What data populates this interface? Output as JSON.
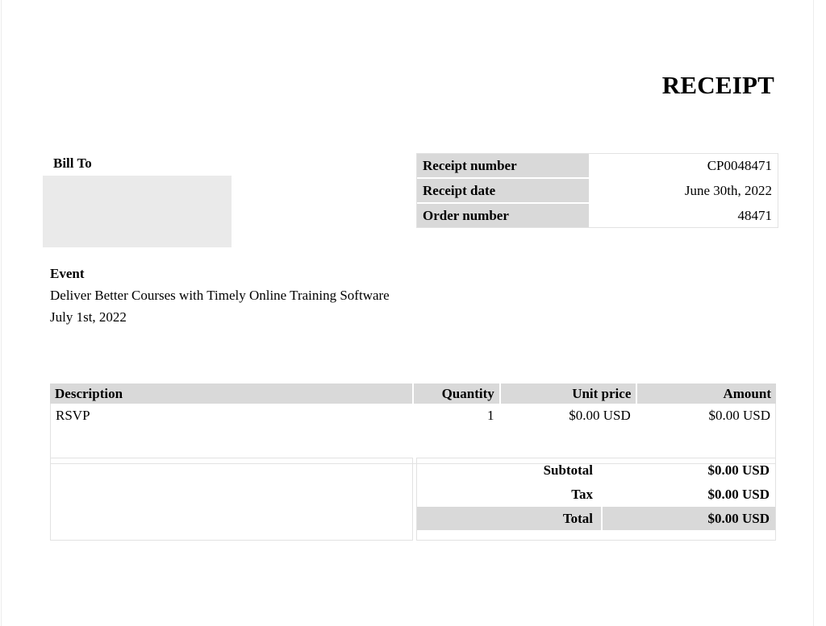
{
  "document": {
    "title": "RECEIPT"
  },
  "bill_to": {
    "label": "Bill To",
    "value": ""
  },
  "meta": {
    "rows": [
      {
        "label": "Receipt number",
        "value": "CP0048471"
      },
      {
        "label": "Receipt date",
        "value": "June 30th, 2022"
      },
      {
        "label": "Order number",
        "value": "48471"
      }
    ]
  },
  "event": {
    "label": "Event",
    "name": "Deliver Better Courses with Timely Online Training Software",
    "date": "July 1st, 2022"
  },
  "items": {
    "headers": {
      "description": "Description",
      "quantity": "Quantity",
      "unit_price": "Unit price",
      "amount": "Amount"
    },
    "rows": [
      {
        "description": "RSVP",
        "quantity": "1",
        "unit_price": "$0.00 USD",
        "amount": "$0.00 USD"
      }
    ]
  },
  "totals": {
    "subtotal_label": "Subtotal",
    "subtotal_value": "$0.00 USD",
    "tax_label": "Tax",
    "tax_value": "$0.00 USD",
    "total_label": "Total",
    "total_value": "$0.00 USD"
  },
  "colors": {
    "header_gray": "#d9d9d9",
    "placeholder_gray": "#eaeaea",
    "border_gray": "#e2e2e2",
    "text": "#000000",
    "page_background": "#ffffff"
  }
}
